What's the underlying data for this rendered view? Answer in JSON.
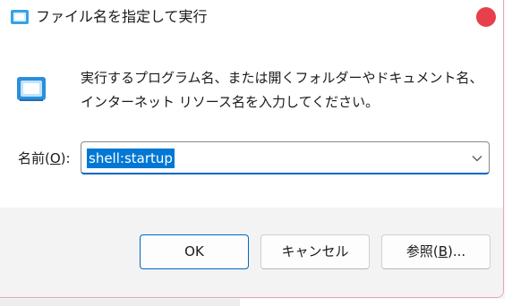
{
  "window": {
    "title": "ファイル名を指定して実行"
  },
  "description": "実行するプログラム名、または開くフォルダーやドキュメント名、インターネット リソース名を入力してください。",
  "name_field": {
    "label_prefix": "名前(",
    "label_key": "O",
    "label_suffix": "):",
    "value": "shell:startup"
  },
  "buttons": {
    "ok": "OK",
    "cancel": "キャンセル",
    "browse_prefix": "参照(",
    "browse_key": "B",
    "browse_suffix": ")..."
  },
  "colors": {
    "accent": "#0078d4",
    "close": "#e8404b"
  }
}
